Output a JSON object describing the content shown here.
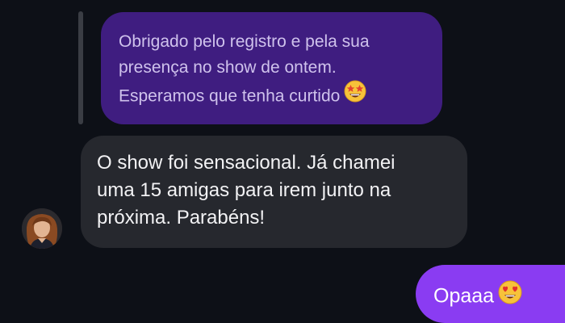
{
  "quoted_message": {
    "lines": [
      "Obrigado pelo registro e pela sua",
      "presença no show de ontem.",
      "Esperamos que tenha curtido"
    ],
    "emoji": "star-struck-emoji"
  },
  "incoming_message": {
    "lines": [
      "O show foi sensacional. Já chamei",
      "uma 15 amigas para irem junto na",
      "próxima. Parabéns!"
    ]
  },
  "outgoing_message": {
    "text": "Opaaa",
    "emoji": "heart-eyes-emoji"
  },
  "colors": {
    "background": "#0d1017",
    "quoted_bubble": "#3f1d80",
    "incoming_bubble": "#26282e",
    "outgoing_bubble": "#8a3cf2"
  }
}
